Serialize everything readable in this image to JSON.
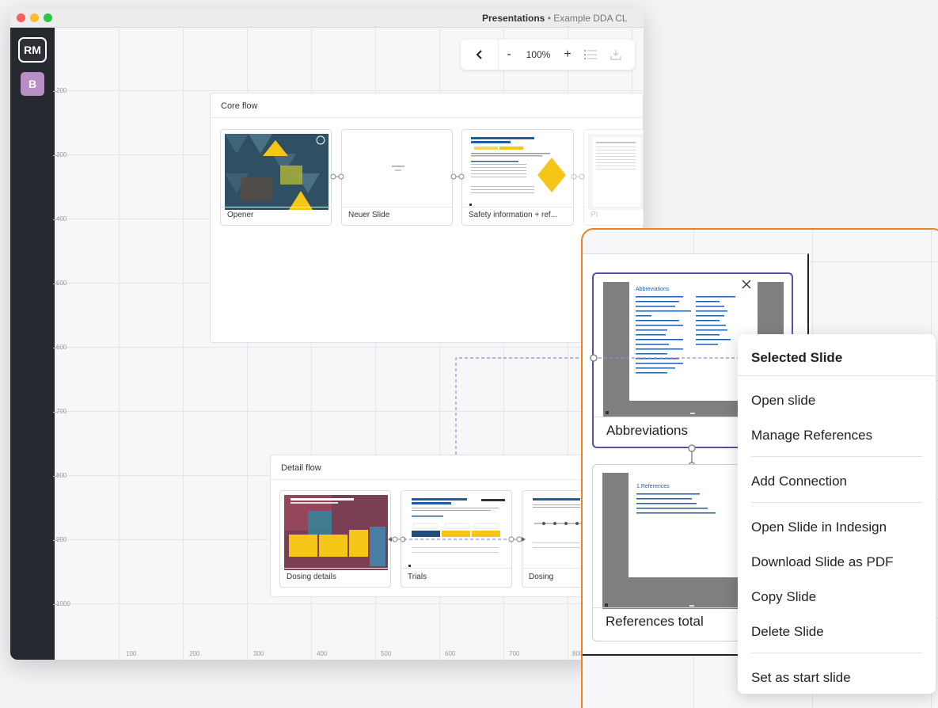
{
  "window": {
    "title": "Presentations",
    "title_separator": " • ",
    "subtitle": "Example DDA CL"
  },
  "sidebar": {
    "avatar_primary": "RM",
    "avatar_secondary": "B"
  },
  "toolbar": {
    "back_icon": "chevron-left-icon",
    "zoom_out": "-",
    "zoom_level": "100%",
    "zoom_in": "+"
  },
  "rulers": {
    "y": [
      "200",
      "300",
      "400",
      "500",
      "600",
      "700",
      "800",
      "900",
      "1000"
    ],
    "x": [
      "100",
      "200",
      "300",
      "400",
      "500",
      "600",
      "700",
      "800"
    ]
  },
  "core_flow": {
    "title": "Core flow",
    "cards": [
      {
        "label": "Opener"
      },
      {
        "label": "Neuer Slide"
      },
      {
        "label": "Safety information + ref..."
      },
      {
        "label": "PI"
      }
    ]
  },
  "detail_flow": {
    "title": "Detail flow",
    "cards": [
      {
        "label": "Dosing details"
      },
      {
        "label": "Trials"
      },
      {
        "label": "Dosing"
      }
    ]
  },
  "zoom_view": {
    "selected_card": {
      "label": "Abbreviations",
      "thumb_heading": "Abbreviations"
    },
    "second_card": {
      "label": "References total",
      "thumb_heading": "1.References"
    }
  },
  "context_menu": {
    "header": "Selected Slide",
    "items": [
      "Open slide",
      "Manage References",
      "Add Connection",
      "Open Slide in Indesign",
      "Download Slide as PDF",
      "Copy Slide",
      "Delete Slide",
      "Set as start slide"
    ]
  },
  "colors": {
    "accent_orange": "#ef7f27",
    "selection_purple": "#5a4fa6",
    "sidebar_dark": "#26292f",
    "avatar_b": "#b78fc6"
  }
}
